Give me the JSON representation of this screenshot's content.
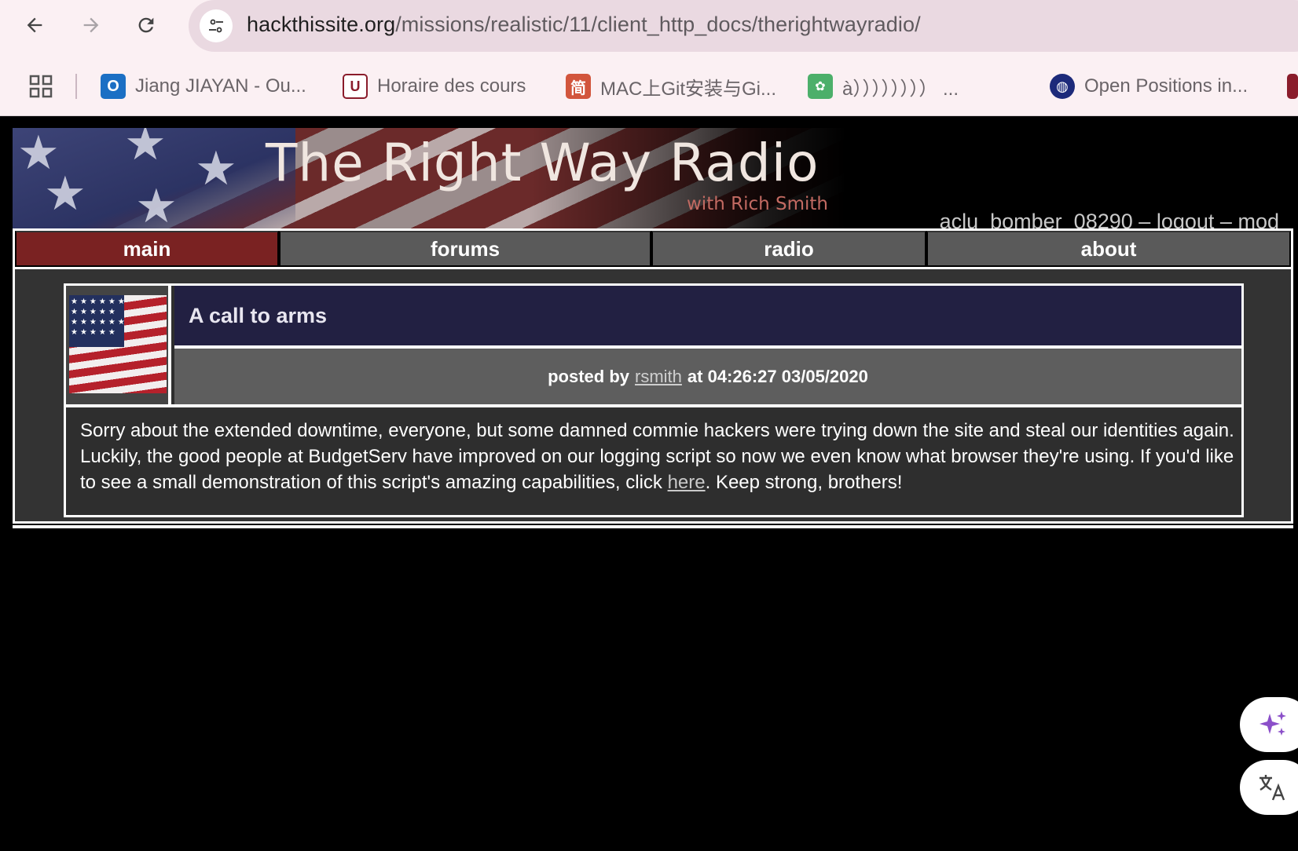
{
  "browser": {
    "url_host": "hackthissite.org",
    "url_path": "/missions/realistic/11/client_http_docs/therightwayradio/",
    "bookmarks": [
      {
        "label": "Jiang JIAYAN - Ou...",
        "icon": "outlook-icon"
      },
      {
        "label": "Horaire des cours",
        "icon": "university-icon"
      },
      {
        "label": "MAC上Git安装与Gi...",
        "icon": "jian-icon"
      },
      {
        "label": "à）））））））） ...",
        "icon": "paw-icon"
      },
      {
        "label": "Open Positions in...",
        "icon": "globe-icon"
      }
    ],
    "jian_char": "简"
  },
  "site": {
    "title": "The Right Way Radio",
    "subtitle": "with Rich Smith",
    "user": "aclu_bomber_08290",
    "sep": "–",
    "logout": "logout",
    "mod": "mod"
  },
  "nav": {
    "tabs": [
      "main",
      "forums",
      "radio",
      "about"
    ],
    "active": "main"
  },
  "post": {
    "title": "A call to arms",
    "posted_by": "posted by",
    "author": "rsmith",
    "at": "at 04:26:27 03/05/2020",
    "body_before": "Sorry about the extended downtime, everyone, but some damned commie hackers were trying down the site and steal our identities again. Luckily, the good people at BudgetServ have improved on our logging script so now we even know what browser they're using. If you'd like to see a small demonstration of this script's amazing capabilities, click ",
    "link_text": "here",
    "body_after": ". Keep strong, brothers!"
  },
  "colors": {
    "active_tab": "#7a2222",
    "tab": "#5a5a5a",
    "post_title_bg": "#222042"
  }
}
